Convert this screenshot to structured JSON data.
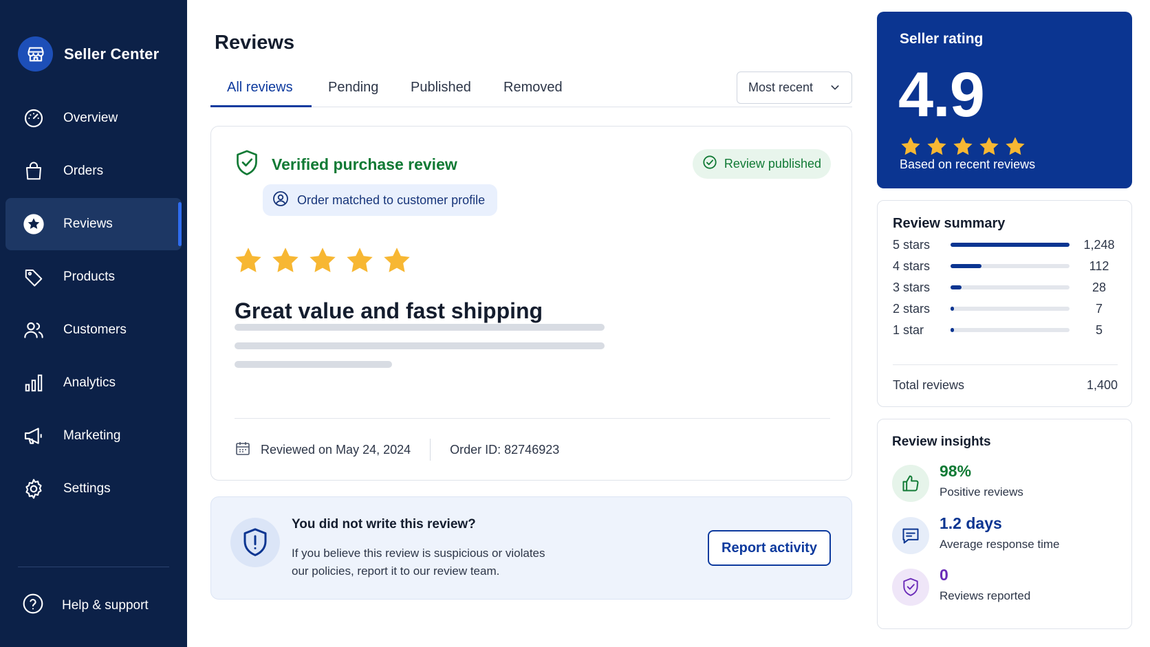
{
  "sidebar": {
    "brand": "Seller Center",
    "items": [
      {
        "label": "Overview",
        "icon": "dashboard-icon"
      },
      {
        "label": "Orders",
        "icon": "shopping-bag-icon"
      },
      {
        "label": "Reviews",
        "icon": "star-icon",
        "active": true
      },
      {
        "label": "Products",
        "icon": "tag-icon"
      },
      {
        "label": "Customers",
        "icon": "users-icon"
      },
      {
        "label": "Analytics",
        "icon": "bar-chart-icon"
      },
      {
        "label": "Marketing",
        "icon": "megaphone-icon"
      },
      {
        "label": "Settings",
        "icon": "gear-icon"
      }
    ],
    "help": "Help & support"
  },
  "main": {
    "title": "Reviews",
    "tabs": [
      "All reviews",
      "Pending",
      "Published",
      "Removed"
    ],
    "active_tab": "All reviews",
    "sort": "Most recent"
  },
  "review": {
    "verified_label": "Verified purchase review",
    "status": "Review published",
    "match": "Order matched to customer profile",
    "rating": 5,
    "headline": "Great value and fast shipping",
    "reviewed_on": "Reviewed on May 24, 2024",
    "order_id": "Order ID: 82746923"
  },
  "report": {
    "title": "You did not write this review?",
    "text_line1": "If you believe this review is suspicious or violates",
    "text_line2": "our policies, report it to our review team.",
    "button": "Report activity"
  },
  "rating_card": {
    "label": "Seller rating",
    "value": "4.9",
    "stars": 5,
    "sub": "Based on recent reviews"
  },
  "summary": {
    "title": "Review summary",
    "rows": [
      {
        "label": "5 stars",
        "count": "1,248",
        "fraction": 1.0
      },
      {
        "label": "4 stars",
        "count": "112",
        "fraction": 0.26
      },
      {
        "label": "3 stars",
        "count": "28",
        "fraction": 0.09
      },
      {
        "label": "2 stars",
        "count": "7",
        "fraction": 0.03
      },
      {
        "label": "1 star",
        "count": "5",
        "fraction": 0.02
      }
    ],
    "total_label": "Total reviews",
    "total_value": "1,400"
  },
  "insights": {
    "title": "Review insights",
    "items": [
      {
        "value": "98%",
        "desc": "Positive reviews",
        "icon": "thumbs-up-icon",
        "color": "#117a35",
        "bg": "#e6f4ea"
      },
      {
        "value": "1.2 days",
        "desc": "Average response time",
        "icon": "chat-icon",
        "color": "#0b3591",
        "bg": "#e6edf9"
      },
      {
        "value": "0",
        "desc": "Reviews reported",
        "icon": "shield-check-icon",
        "color": "#6a2bb8",
        "bg": "#efe6f8"
      }
    ]
  },
  "colors": {
    "sidebar_bg": "#0c2148",
    "accent": "#0d3a9e",
    "success": "#117a35",
    "star": "#f7b733"
  }
}
